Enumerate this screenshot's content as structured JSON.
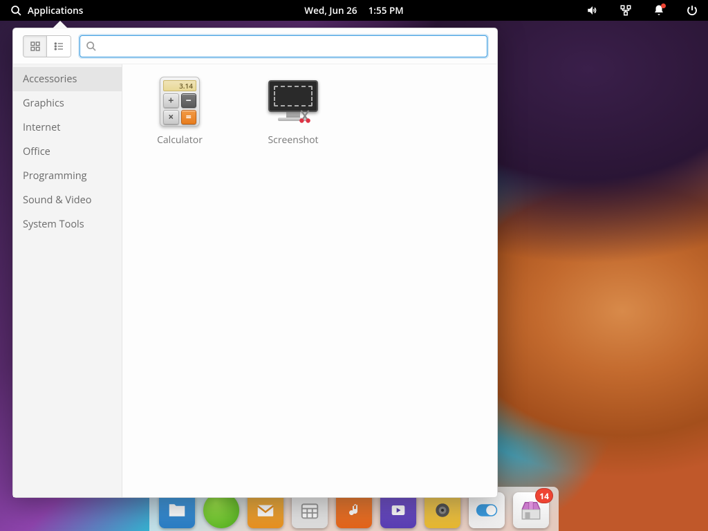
{
  "topbar": {
    "apps_label": "Applications",
    "date": "Wed, Jun 26",
    "time": "1:55 PM"
  },
  "menu": {
    "search_placeholder": "",
    "categories": [
      "Accessories",
      "Graphics",
      "Internet",
      "Office",
      "Programming",
      "Sound & Video",
      "System Tools"
    ],
    "active_category": 0,
    "apps": [
      {
        "name": "Calculator",
        "calc_display": "3.14"
      },
      {
        "name": "Screenshot"
      }
    ]
  },
  "dock": {
    "badge_count": "14"
  }
}
